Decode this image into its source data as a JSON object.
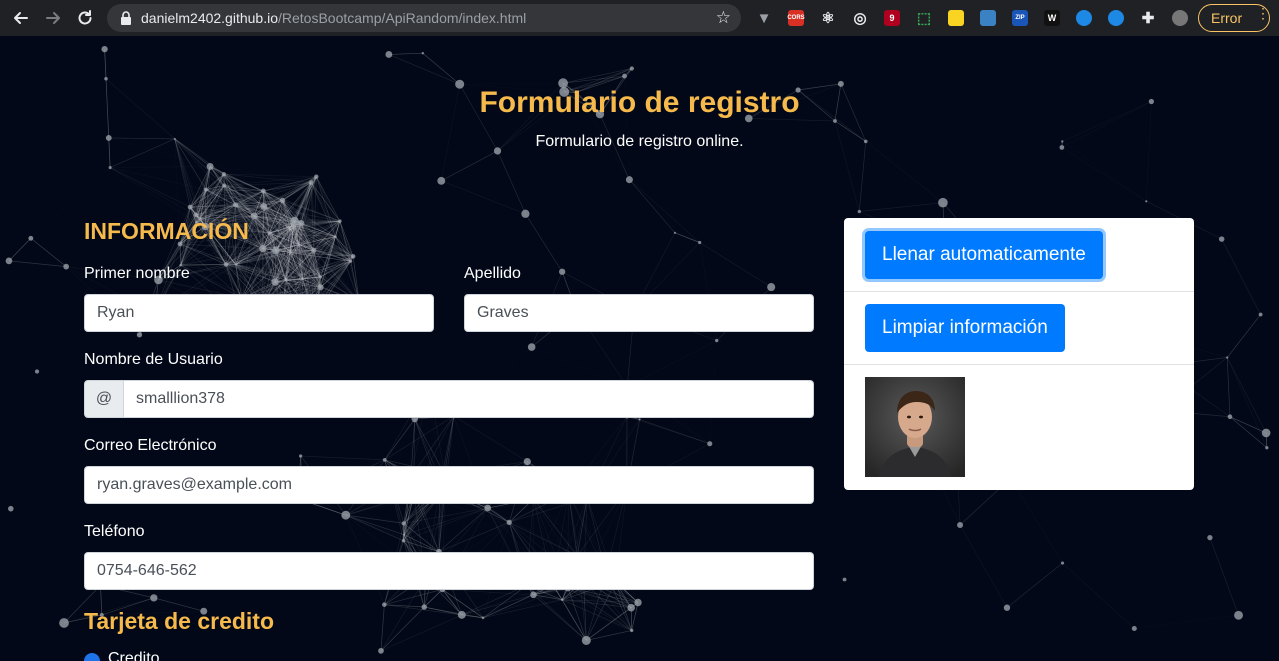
{
  "browser": {
    "url_host": "danielm2402.github.io",
    "url_path": "/RetosBootcamp/ApiRandom/index.html",
    "extensions": [
      {
        "icon": "vuetify-icon",
        "text": "",
        "color": "#9aa0a6"
      },
      {
        "icon": "cors-icon",
        "text": "CORS",
        "color": "#d93025"
      },
      {
        "icon": "react-icon",
        "text": "",
        "color": "#e8eaed"
      },
      {
        "icon": "target-icon",
        "text": "",
        "color": "#e8eaed"
      },
      {
        "icon": "ublock-icon",
        "text": "9",
        "color": "#b00020"
      },
      {
        "icon": "screen-capture-icon",
        "text": "",
        "color": "#34a853"
      },
      {
        "icon": "ghost-icon",
        "text": "",
        "color": "#f9d423"
      },
      {
        "icon": "square-icon",
        "text": "",
        "color": "#3b82c4"
      },
      {
        "icon": "zip-icon",
        "text": "ZIP",
        "color": "#1a56b8"
      },
      {
        "icon": "w-icon",
        "text": "W",
        "color": "#111111"
      },
      {
        "icon": "wave-icon",
        "text": "",
        "color": "#1e88e5"
      },
      {
        "icon": "link-icon",
        "text": "",
        "color": "#1e88e5"
      },
      {
        "icon": "puzzle-icon",
        "text": "",
        "color": "#e8eaed"
      },
      {
        "icon": "profile-avatar-icon",
        "text": "",
        "color": "#777777"
      }
    ],
    "error_label": "Error"
  },
  "header": {
    "title": "Formulario de registro",
    "subtitle": "Formulario de registro online."
  },
  "info": {
    "section_title": "INFORMACIÓN",
    "first_name_label": "Primer nombre",
    "first_name_value": "Ryan",
    "last_name_label": "Apellido",
    "last_name_value": "Graves",
    "username_label": "Nombre de Usuario",
    "username_prefix": "@",
    "username_value": "smalllion378",
    "email_label": "Correo Electrónico",
    "email_value": "ryan.graves@example.com",
    "phone_label": "Teléfono",
    "phone_value": "0754-646-562"
  },
  "card_section": {
    "title": "Tarjeta de credito",
    "option_label": "Credito"
  },
  "sidebar": {
    "fill_button": "Llenar automaticamente",
    "clear_button": "Limpiar información"
  },
  "colors": {
    "accent": "#f6b94c",
    "primary": "#007bff",
    "background": "#020817"
  }
}
